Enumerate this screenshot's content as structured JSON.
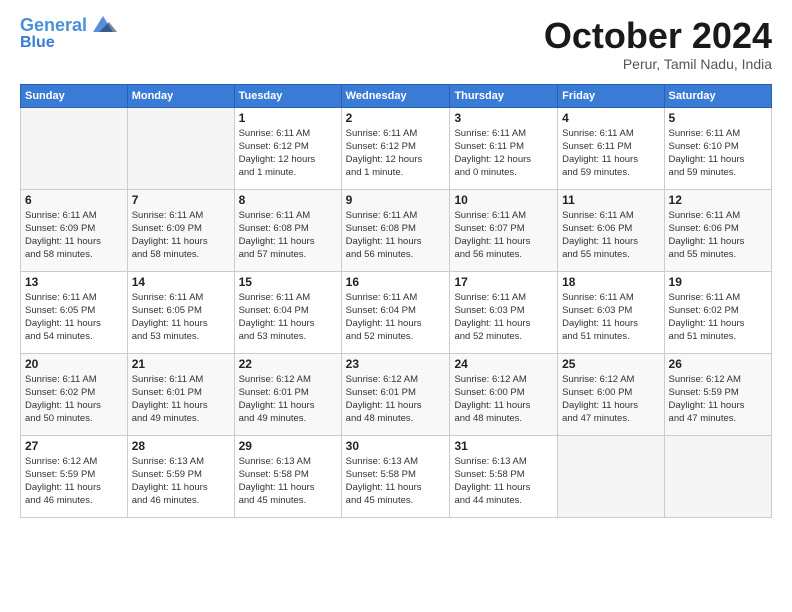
{
  "logo": {
    "line1": "General",
    "line2": "Blue"
  },
  "title": "October 2024",
  "subtitle": "Perur, Tamil Nadu, India",
  "header_days": [
    "Sunday",
    "Monday",
    "Tuesday",
    "Wednesday",
    "Thursday",
    "Friday",
    "Saturday"
  ],
  "weeks": [
    [
      {
        "day": "",
        "info": ""
      },
      {
        "day": "",
        "info": ""
      },
      {
        "day": "1",
        "info": "Sunrise: 6:11 AM\nSunset: 6:12 PM\nDaylight: 12 hours\nand 1 minute."
      },
      {
        "day": "2",
        "info": "Sunrise: 6:11 AM\nSunset: 6:12 PM\nDaylight: 12 hours\nand 1 minute."
      },
      {
        "day": "3",
        "info": "Sunrise: 6:11 AM\nSunset: 6:11 PM\nDaylight: 12 hours\nand 0 minutes."
      },
      {
        "day": "4",
        "info": "Sunrise: 6:11 AM\nSunset: 6:11 PM\nDaylight: 11 hours\nand 59 minutes."
      },
      {
        "day": "5",
        "info": "Sunrise: 6:11 AM\nSunset: 6:10 PM\nDaylight: 11 hours\nand 59 minutes."
      }
    ],
    [
      {
        "day": "6",
        "info": "Sunrise: 6:11 AM\nSunset: 6:09 PM\nDaylight: 11 hours\nand 58 minutes."
      },
      {
        "day": "7",
        "info": "Sunrise: 6:11 AM\nSunset: 6:09 PM\nDaylight: 11 hours\nand 58 minutes."
      },
      {
        "day": "8",
        "info": "Sunrise: 6:11 AM\nSunset: 6:08 PM\nDaylight: 11 hours\nand 57 minutes."
      },
      {
        "day": "9",
        "info": "Sunrise: 6:11 AM\nSunset: 6:08 PM\nDaylight: 11 hours\nand 56 minutes."
      },
      {
        "day": "10",
        "info": "Sunrise: 6:11 AM\nSunset: 6:07 PM\nDaylight: 11 hours\nand 56 minutes."
      },
      {
        "day": "11",
        "info": "Sunrise: 6:11 AM\nSunset: 6:06 PM\nDaylight: 11 hours\nand 55 minutes."
      },
      {
        "day": "12",
        "info": "Sunrise: 6:11 AM\nSunset: 6:06 PM\nDaylight: 11 hours\nand 55 minutes."
      }
    ],
    [
      {
        "day": "13",
        "info": "Sunrise: 6:11 AM\nSunset: 6:05 PM\nDaylight: 11 hours\nand 54 minutes."
      },
      {
        "day": "14",
        "info": "Sunrise: 6:11 AM\nSunset: 6:05 PM\nDaylight: 11 hours\nand 53 minutes."
      },
      {
        "day": "15",
        "info": "Sunrise: 6:11 AM\nSunset: 6:04 PM\nDaylight: 11 hours\nand 53 minutes."
      },
      {
        "day": "16",
        "info": "Sunrise: 6:11 AM\nSunset: 6:04 PM\nDaylight: 11 hours\nand 52 minutes."
      },
      {
        "day": "17",
        "info": "Sunrise: 6:11 AM\nSunset: 6:03 PM\nDaylight: 11 hours\nand 52 minutes."
      },
      {
        "day": "18",
        "info": "Sunrise: 6:11 AM\nSunset: 6:03 PM\nDaylight: 11 hours\nand 51 minutes."
      },
      {
        "day": "19",
        "info": "Sunrise: 6:11 AM\nSunset: 6:02 PM\nDaylight: 11 hours\nand 51 minutes."
      }
    ],
    [
      {
        "day": "20",
        "info": "Sunrise: 6:11 AM\nSunset: 6:02 PM\nDaylight: 11 hours\nand 50 minutes."
      },
      {
        "day": "21",
        "info": "Sunrise: 6:11 AM\nSunset: 6:01 PM\nDaylight: 11 hours\nand 49 minutes."
      },
      {
        "day": "22",
        "info": "Sunrise: 6:12 AM\nSunset: 6:01 PM\nDaylight: 11 hours\nand 49 minutes."
      },
      {
        "day": "23",
        "info": "Sunrise: 6:12 AM\nSunset: 6:01 PM\nDaylight: 11 hours\nand 48 minutes."
      },
      {
        "day": "24",
        "info": "Sunrise: 6:12 AM\nSunset: 6:00 PM\nDaylight: 11 hours\nand 48 minutes."
      },
      {
        "day": "25",
        "info": "Sunrise: 6:12 AM\nSunset: 6:00 PM\nDaylight: 11 hours\nand 47 minutes."
      },
      {
        "day": "26",
        "info": "Sunrise: 6:12 AM\nSunset: 5:59 PM\nDaylight: 11 hours\nand 47 minutes."
      }
    ],
    [
      {
        "day": "27",
        "info": "Sunrise: 6:12 AM\nSunset: 5:59 PM\nDaylight: 11 hours\nand 46 minutes."
      },
      {
        "day": "28",
        "info": "Sunrise: 6:13 AM\nSunset: 5:59 PM\nDaylight: 11 hours\nand 46 minutes."
      },
      {
        "day": "29",
        "info": "Sunrise: 6:13 AM\nSunset: 5:58 PM\nDaylight: 11 hours\nand 45 minutes."
      },
      {
        "day": "30",
        "info": "Sunrise: 6:13 AM\nSunset: 5:58 PM\nDaylight: 11 hours\nand 45 minutes."
      },
      {
        "day": "31",
        "info": "Sunrise: 6:13 AM\nSunset: 5:58 PM\nDaylight: 11 hours\nand 44 minutes."
      },
      {
        "day": "",
        "info": ""
      },
      {
        "day": "",
        "info": ""
      }
    ]
  ]
}
